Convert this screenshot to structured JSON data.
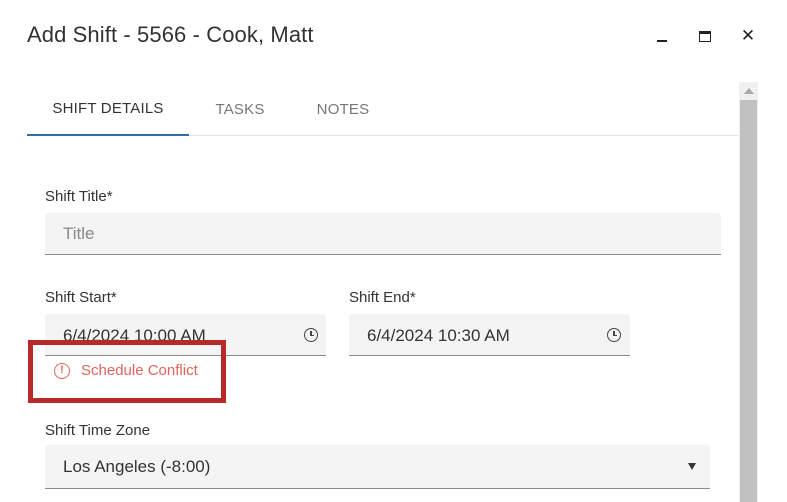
{
  "dialog": {
    "title": "Add Shift - 5566 - Cook, Matt",
    "minimize_icon": "minimize-icon",
    "maximize_icon": "maximize-icon",
    "close_icon": "close-icon",
    "close_glyph": "✕"
  },
  "tabs": [
    {
      "label": "SHIFT DETAILS",
      "active": true
    },
    {
      "label": "TASKS",
      "active": false
    },
    {
      "label": "NOTES",
      "active": false
    }
  ],
  "form": {
    "shift_title": {
      "label": "Shift Title*",
      "placeholder": "Title",
      "value": ""
    },
    "shift_start": {
      "label": "Shift Start*",
      "value": "6/4/2024 10:00 AM",
      "icon": "clock-icon"
    },
    "shift_end": {
      "label": "Shift End*",
      "value": "6/4/2024 10:30 AM",
      "icon": "clock-icon"
    },
    "conflict": {
      "text": "Schedule Conflict",
      "icon": "alert-circle-icon",
      "glyph": "!"
    },
    "time_zone": {
      "label": "Shift Time Zone",
      "value": "Los Angeles (-8:00)",
      "icon": "caret-down-icon"
    }
  },
  "colors": {
    "accent": "#2f6fa6",
    "error": "#e0645a",
    "highlight": "#b62a2a"
  }
}
